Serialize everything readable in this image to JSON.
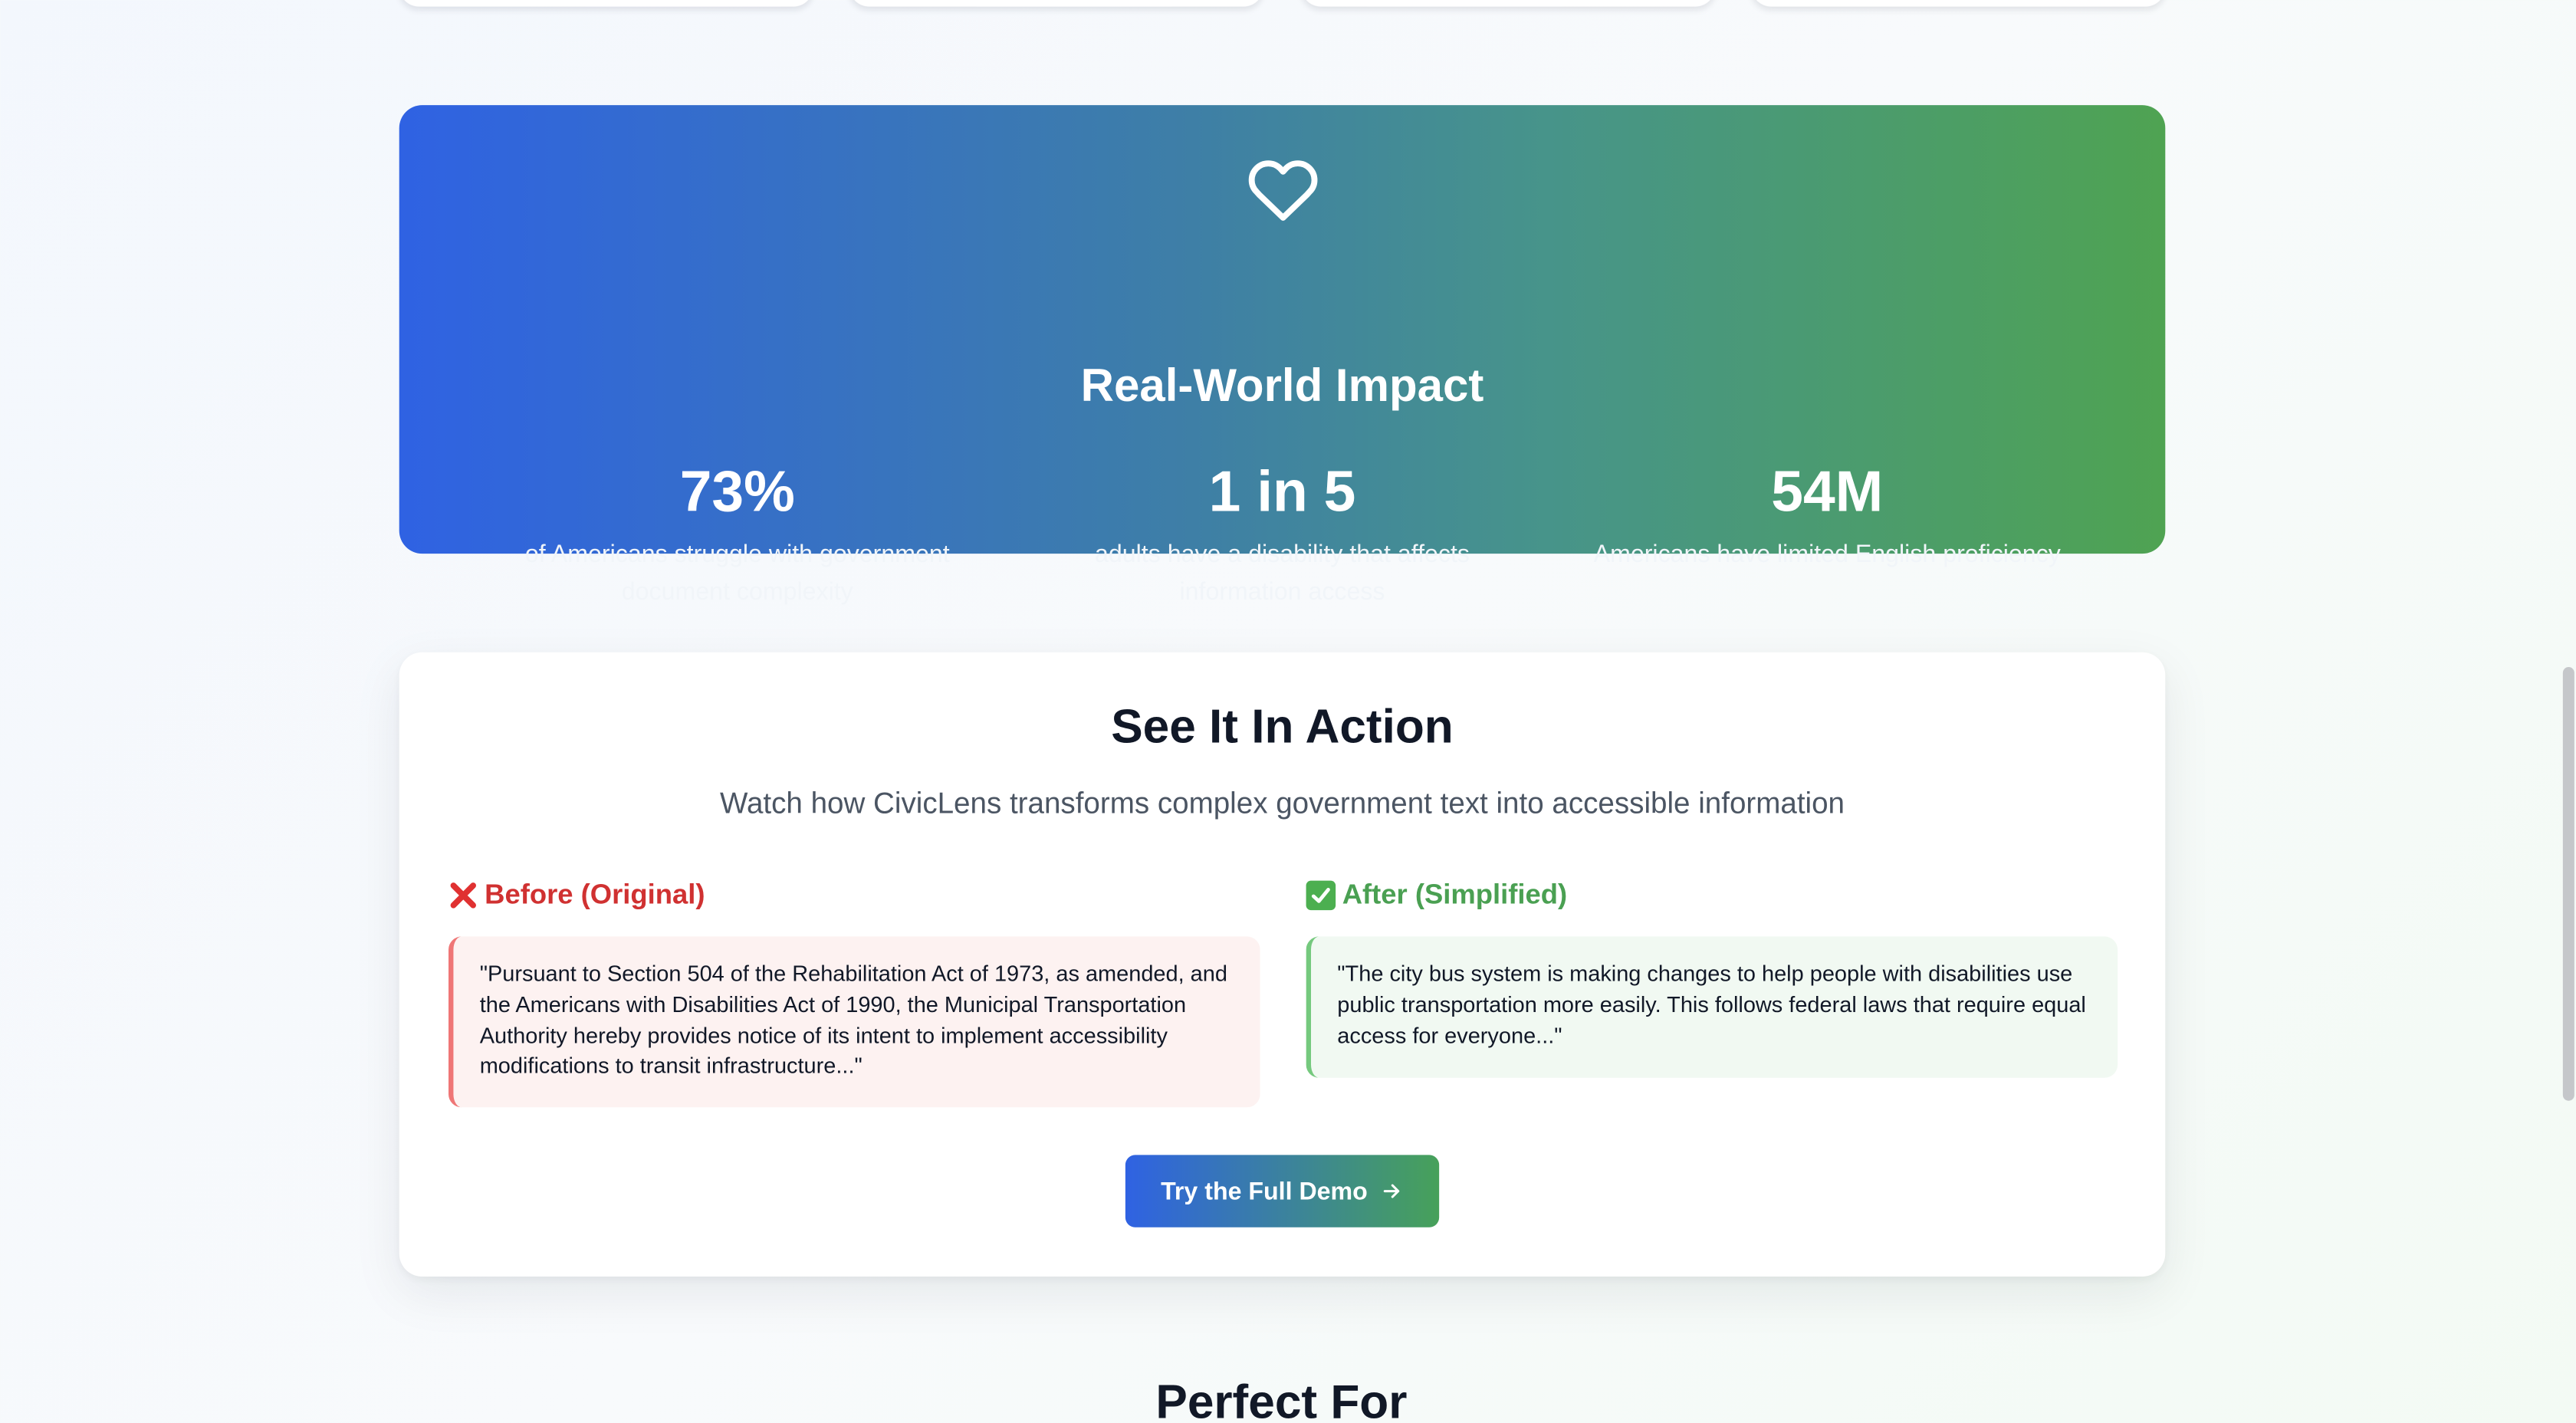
{
  "impact": {
    "heart_icon": "heart-outline-icon",
    "title": "Real-World Impact",
    "stats": [
      {
        "value": "73%",
        "desc": "of Americans struggle with government document complexity"
      },
      {
        "value": "1 in 5",
        "desc": "adults have a disability that affects information access"
      },
      {
        "value": "54M",
        "desc": "Americans have limited English proficiency"
      }
    ]
  },
  "action": {
    "title": "See It In Action",
    "subtitle": "Watch how CivicLens transforms complex government text into accessible information",
    "before": {
      "heading": "Before (Original)",
      "icon": "cross-mark-icon",
      "text": "\"Pursuant to Section 504 of the Rehabilitation Act of 1973, as amended, and the Americans with Disabilities Act of 1990, the Municipal Transportation Authority hereby provides notice of its intent to implement accessibility modifications to transit infrastructure...\""
    },
    "after": {
      "heading": "After (Simplified)",
      "icon": "check-mark-icon",
      "text": "\"The city bus system is making changes to help people with disabilities use public transportation more easily. This follows federal laws that require equal access for everyone...\""
    },
    "cta_label": "Try the Full Demo",
    "cta_icon": "arrow-right-icon"
  },
  "perfect_for": {
    "title": "Perfect For"
  },
  "colors": {
    "gradient_start": "#2f62e3",
    "gradient_end": "#4fa352",
    "before_red": "#d03131",
    "after_green": "#4aa052"
  }
}
